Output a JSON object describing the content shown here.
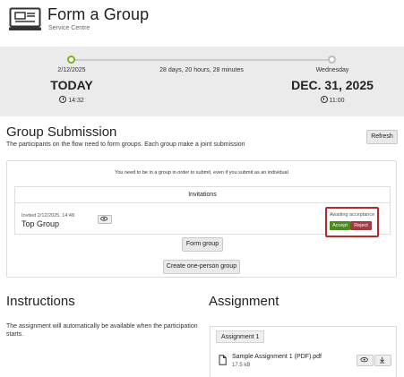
{
  "header": {
    "title": "Form a Group",
    "subtitle": "Service Centre",
    "icon": "laptop-icon"
  },
  "timeline": {
    "start_date": "2/12/2025",
    "start_label": "TODAY",
    "start_time": "14:32",
    "remaining": "28 days, 20 hours, 28 minutes",
    "end_day": "Wednesday",
    "end_label": "DEC. 31, 2025",
    "end_time": "11:00",
    "progress_fraction": 0.0,
    "colors": {
      "done": "#7ab51d",
      "pending": "#cccccc"
    }
  },
  "group_submission": {
    "title": "Group Submission",
    "description": "The participants on the flow need to form groups. Each group make a joint submission",
    "refresh_label": "Refresh",
    "note": "You need to be in a group in order to submit, even if you submit as an individual",
    "invitations": {
      "heading": "Invitations",
      "items": [
        {
          "meta": "Invited 2/12/2025, 14:48",
          "name": "Top Group",
          "status": "Awaiting acceptance",
          "accept_label": "Accept",
          "reject_label": "Reject"
        }
      ]
    },
    "form_group_label": "Form group",
    "create_one_label": "Create one-person group"
  },
  "instructions": {
    "title": "Instructions",
    "text": "The assignment will automatically be available when the participation starts."
  },
  "assignment": {
    "title": "Assignment",
    "tag": "Assignment 1",
    "file_name": "Sample Assignment 1 (PDF).pdf",
    "file_size": "17.5 kB"
  },
  "colors": {
    "accept": "#4c8a1d",
    "reject": "#a33a45",
    "highlight_border": "#b52a2a",
    "timeline_bg": "#ebebeb"
  }
}
